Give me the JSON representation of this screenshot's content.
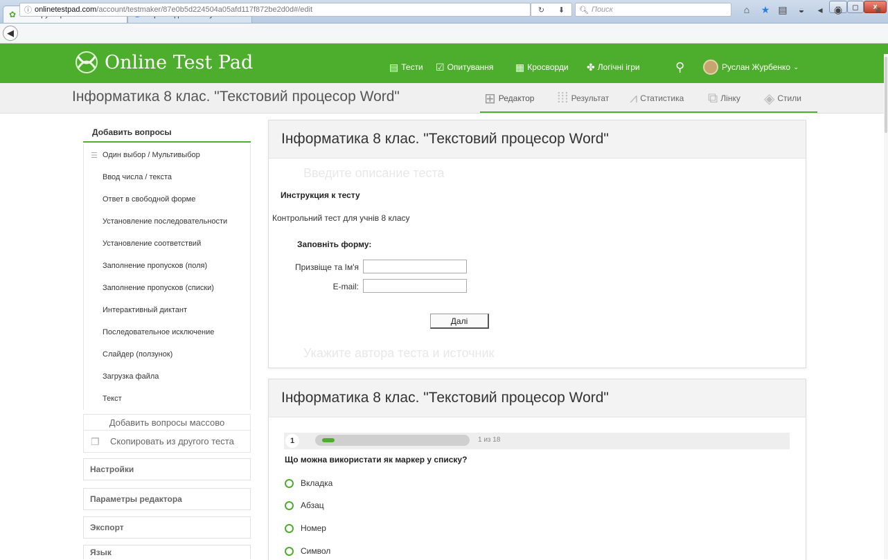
{
  "browser": {
    "tabs": [
      {
        "label": "Конструктор тестів",
        "active": true
      },
      {
        "label": "перекладач - Пошук Goo...",
        "active": false
      }
    ],
    "new_tab": "+",
    "url": "onlinetestpad.com/account/testmaker/87e0b5d224504a05afd117f872be2d0d#/edit",
    "url_host": "onlinetestpad.com",
    "url_path": "/account/testmaker/87e0b5d224504a05afd117f872be2d0d#/edit",
    "search_placeholder": "Поиск",
    "window_controls": [
      "–",
      "◻",
      "x"
    ]
  },
  "site": {
    "brand": "Online Test Pad",
    "nav": [
      {
        "label": "Тести",
        "icon": "document-icon"
      },
      {
        "label": "Опитування",
        "icon": "survey-icon"
      },
      {
        "label": "Кросворди",
        "icon": "grid-icon"
      },
      {
        "label": "Логічні ігри",
        "icon": "puzzle-icon"
      }
    ],
    "user": "Руслан Журбенко"
  },
  "page": {
    "title": "Інформатика 8 клас. \"Текстовий процесор Word\"",
    "subnav": [
      {
        "label": "Редактор",
        "icon": "hierarchy-icon"
      },
      {
        "label": "Результат",
        "icon": "dots-grid-icon"
      },
      {
        "label": "Статистика",
        "icon": "line-chart-icon"
      },
      {
        "label": "Лінку",
        "icon": "share-icon"
      },
      {
        "label": "Стили",
        "icon": "layers-icon"
      }
    ]
  },
  "sidebar": {
    "heading": "Добавить вопросы",
    "items": [
      "Один выбор / Мультивыбор",
      "Ввод числа / текста",
      "Ответ в свободной форме",
      "Установление последовательности",
      "Установление соответствий",
      "Заполнение пропусков (поля)",
      "Заполнение пропусков (списки)",
      "Интерактивный диктант",
      "Последовательное исключение",
      "Слайдер (ползунок)",
      "Загрузка файла",
      "Текст"
    ],
    "mass_add": "Добавить вопросы массово",
    "copy": "Скопировать из другого теста",
    "sections": [
      "Настройки",
      "Параметры редактора",
      "Экспорт",
      "Язык"
    ]
  },
  "intro_card": {
    "title": "Інформатика 8 клас. \"Текстовий процесор Word\"",
    "desc_placeholder": "Введите описание теста",
    "instruction_label": "Инструкция к тесту",
    "instruction_text": "Контрольний тест для учнів 8 класу",
    "form_heading": "Заповніть форму:",
    "fields": [
      {
        "label": "Призвіще та Ім'я",
        "value": ""
      },
      {
        "label": "E-mail:",
        "value": ""
      }
    ],
    "next_button": "Далі",
    "author_placeholder": "Укажите автора теста и источник"
  },
  "question_card": {
    "title": "Інформатика 8 клас. \"Текстовий процесор Word\"",
    "number": "1",
    "progress_fraction": 0.055,
    "progress_text": "1 из 18",
    "question": "Що можна використати як маркер у списку?",
    "options": [
      "Вкладка",
      "Абзац",
      "Номер",
      "Символ"
    ]
  },
  "colors": {
    "brand_green": "#4dad2c"
  }
}
